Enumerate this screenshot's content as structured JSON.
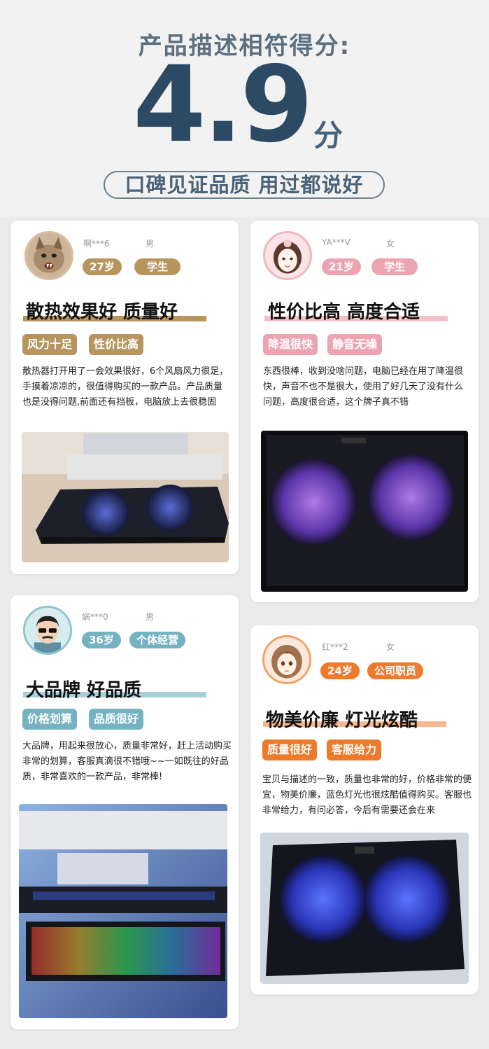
{
  "header": {
    "score_title": "产品描述相符得分:",
    "score_value": "4.9",
    "score_unit": "分",
    "slogan": "口碑见证品质 用过都说好"
  },
  "reviews": [
    {
      "username": "啊***6",
      "gender": "男",
      "age": "27岁",
      "occupation": "学生",
      "headline": "散热效果好 质量好",
      "tags": [
        "风力十足",
        "性价比高"
      ],
      "text": "散热器打开用了一会效果很好，6个风扇风力很足，手摸着凉凉的，很值得购买的一款产品。产品质量也是没得问题,前面还有挡板，电脑放上去很稳固",
      "accent_color": "#b6955f",
      "avatar_icon": "cat-avatar-icon"
    },
    {
      "username": "YA***V",
      "gender": "女",
      "age": "21岁",
      "occupation": "学生",
      "headline": "性价比高 高度合适",
      "tags": [
        "降温很快",
        "静音无噪"
      ],
      "text": "东西很棒，收到没啥问题，电脑已经在用了降温很快，声音不也不是很大，使用了好几天了没有什么问题，高度很合适，这个牌子真不错",
      "accent_color": "#eda4b2",
      "avatar_icon": "girl-avatar-icon"
    },
    {
      "username": "娲***0",
      "gender": "男",
      "age": "36岁",
      "occupation": "个体经营",
      "headline": "大品牌 好品质",
      "tags": [
        "价格划算",
        "品质很好"
      ],
      "text": "大品牌，用起来很放心，质量非常好，赶上活动购买非常的划算，客服真滴很不错哦~~一如既往的好品质，非常喜欢的一款产品，非常棒!",
      "accent_color": "#75b3c2",
      "avatar_icon": "man-avatar-icon"
    },
    {
      "username": "红***2",
      "gender": "女",
      "age": "24岁",
      "occupation": "公司职员",
      "headline": "物美价廉 灯光炫酷",
      "tags": [
        "质量很好",
        "客服给力"
      ],
      "text": "宝贝与描述的一致，质量也非常的好，价格非常的便宜，物美价廉，蓝色灯光也很炫酷值得购买。客服也非常给力，有问必答，今后有需要还会在来",
      "accent_color": "#ee7b2c",
      "avatar_icon": "woman-avatar-icon"
    }
  ]
}
